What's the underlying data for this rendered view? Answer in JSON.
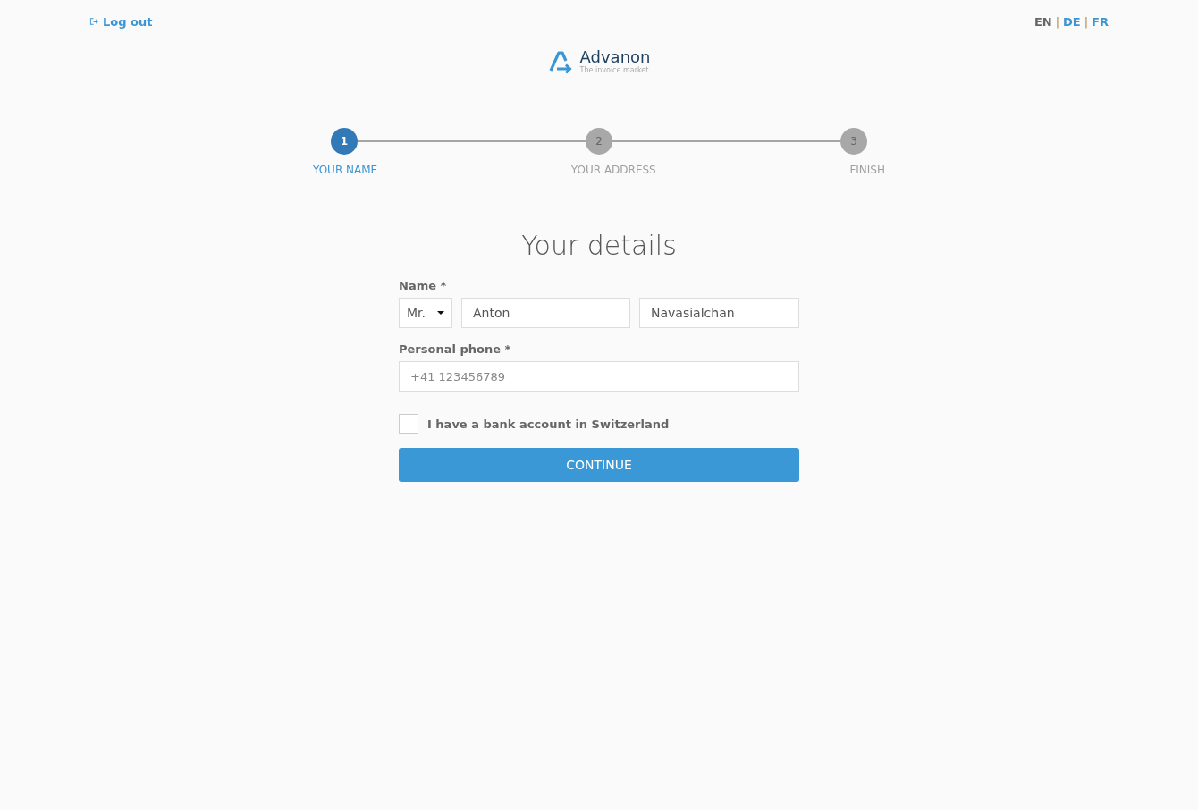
{
  "logout": {
    "label": "Log out"
  },
  "languages": {
    "separator": "|",
    "items": [
      {
        "label": "EN",
        "selected": true
      },
      {
        "label": "DE",
        "selected": false
      },
      {
        "label": "FR",
        "selected": false
      }
    ]
  },
  "logo": {
    "name": "Advanon",
    "tagline": "The invoice market"
  },
  "steps": [
    {
      "number": "1",
      "label": "YOUR NAME",
      "selected": true
    },
    {
      "number": "2",
      "label": "YOUR ADDRESS",
      "selected": false
    },
    {
      "number": "3",
      "label": "FINISH",
      "selected": false
    }
  ],
  "form": {
    "title": "Your details",
    "name_label": "Name *",
    "salutation": "Mr.",
    "first_name": "Anton",
    "last_name": "Navasialchan",
    "phone_label": "Personal phone *",
    "phone": {
      "placeholder": "+41 123456789"
    },
    "bank_checkbox": {
      "label": "I have a bank account in Switzerland",
      "checked": false
    },
    "submit": "CONTINUE"
  }
}
